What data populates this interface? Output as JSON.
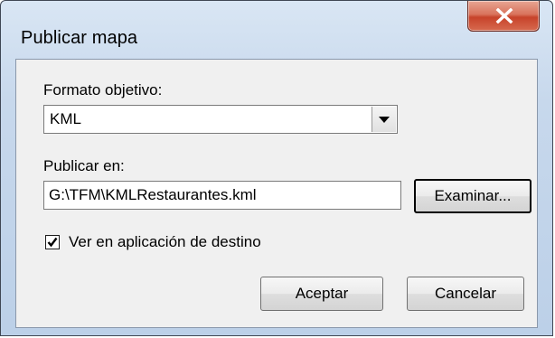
{
  "window": {
    "title": "Publicar mapa"
  },
  "form": {
    "format_label": "Formato objetivo:",
    "format_value": "KML",
    "publish_label": "Publicar en:",
    "publish_path": "G:\\TFM\\KMLRestaurantes.kml",
    "browse_label": "Examinar...",
    "open_in_app_label": "Ver en aplicación de destino",
    "open_in_app_checked": true
  },
  "buttons": {
    "accept_label": "Aceptar",
    "cancel_label": "Cancelar"
  },
  "icons": {
    "close": "close-icon",
    "dropdown": "chevron-down-icon",
    "check": "checkmark-icon"
  },
  "colors": {
    "close_button": "#c7432a",
    "titlebar": "#c7d8ec",
    "client_background": "#f0f0f0"
  }
}
